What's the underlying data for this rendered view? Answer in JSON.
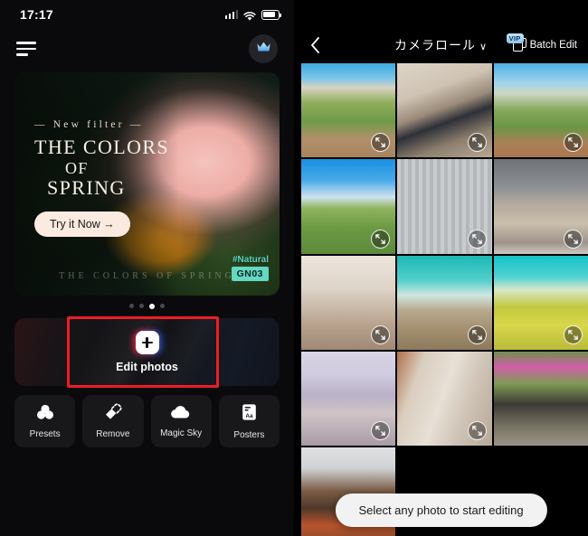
{
  "left": {
    "status": {
      "time": "17:17",
      "signal_icon": "signal-bars-icon",
      "wifi_icon": "wifi-icon",
      "battery_icon": "battery-icon"
    },
    "appbar": {
      "menu_icon": "hamburger-menu-icon",
      "vip_icon": "crown-icon"
    },
    "banner": {
      "eyebrow": "— New filter —",
      "title_line1": "THE COLORS",
      "title_line2": "OF",
      "title_line3": "SPRING",
      "cta": "Try it Now →",
      "footer": "THE COLORS OF SPRING",
      "tag": "#Natural",
      "code": "GN03",
      "dots_total": 4,
      "dots_active": 3
    },
    "edit_card": {
      "label": "Edit photos",
      "plus_icon": "plus-icon",
      "highlighted": true
    },
    "tools": [
      {
        "label": "Presets",
        "icon": "presets-circles-icon"
      },
      {
        "label": "Remove",
        "icon": "eraser-icon"
      },
      {
        "label": "Magic Sky",
        "icon": "cloud-icon"
      },
      {
        "label": "Posters",
        "icon": "poster-text-icon"
      }
    ]
  },
  "right": {
    "bar": {
      "back_icon": "back-chevron-icon",
      "title": "カメラロール",
      "title_chevron": "∨",
      "vip_badge": "VIP",
      "batch_label": "Batch Edit",
      "batch_icon": "stacked-squares-icon"
    },
    "photos": [
      {
        "id": 1,
        "alt": "woman standing on tea field path",
        "selected": false,
        "expand_icon": "expand-icon"
      },
      {
        "id": 2,
        "alt": "woman on wooden stairs in shop",
        "selected": false,
        "expand_icon": "expand-icon"
      },
      {
        "id": 3,
        "alt": "wooden signpost on green field",
        "selected": false,
        "expand_icon": "expand-icon"
      },
      {
        "id": 4,
        "alt": "woman in tea plantation blue sky",
        "selected": true,
        "expand_icon": "expand-icon"
      },
      {
        "id": 5,
        "alt": "woman before corrugated wall",
        "selected": false,
        "expand_icon": "expand-icon"
      },
      {
        "id": 6,
        "alt": "rooftop city view cloudy",
        "selected": false,
        "expand_icon": "expand-icon"
      },
      {
        "id": 7,
        "alt": "woman sitting on sofa indoors",
        "selected": false,
        "expand_icon": "expand-icon"
      },
      {
        "id": 8,
        "alt": "red structure under teal sky",
        "selected": false,
        "expand_icon": "expand-icon"
      },
      {
        "id": 9,
        "alt": "woman in yellow flower field",
        "selected": false,
        "expand_icon": "expand-icon"
      },
      {
        "id": 10,
        "alt": "shopping mall interior",
        "selected": false,
        "expand_icon": "expand-icon"
      },
      {
        "id": 11,
        "alt": "woman by wooden building",
        "selected": false,
        "expand_icon": "expand-icon"
      },
      {
        "id": 12,
        "alt": "pink flowers over alley steps",
        "selected": false,
        "expand_icon": "expand-icon"
      },
      {
        "id": 13,
        "alt": "back of head at desk office",
        "selected": false,
        "expand_icon": "expand-icon"
      }
    ],
    "toast": "Select any photo to start editing"
  },
  "colors": {
    "accent_red": "#ee1c25",
    "vip_blue": "#8cc4ef",
    "code_teal": "#63d9c2"
  }
}
